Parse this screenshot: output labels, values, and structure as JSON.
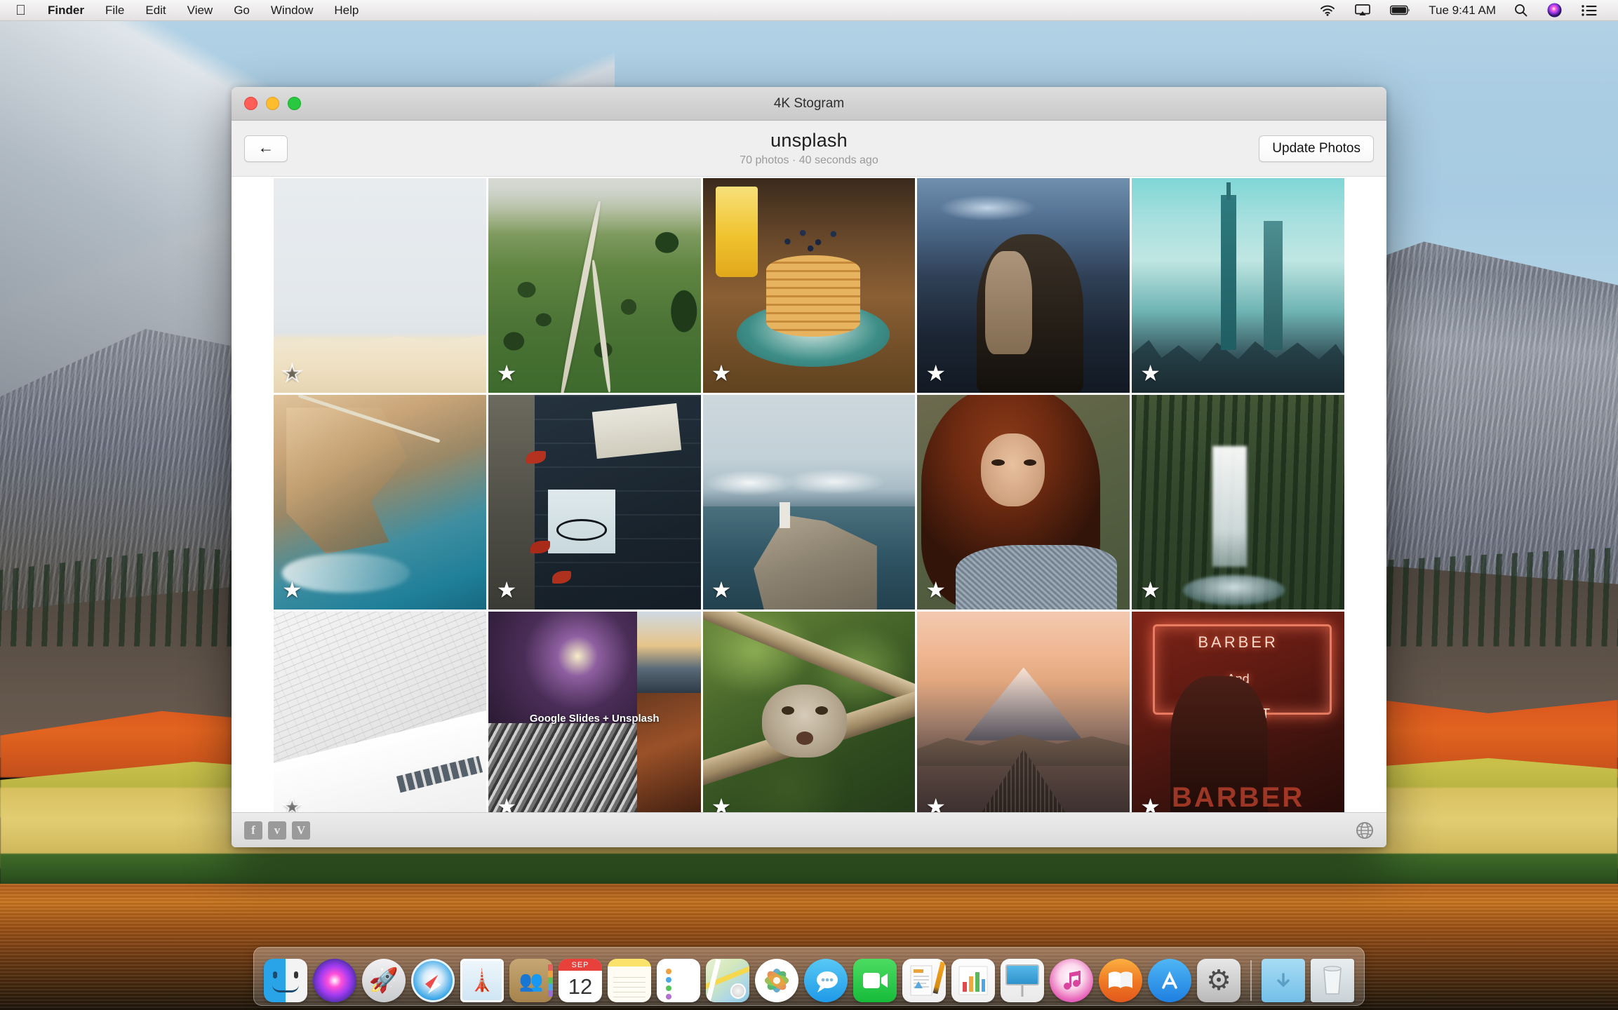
{
  "menubar": {
    "apple_icon": "apple-logo",
    "items": [
      "Finder",
      "File",
      "Edit",
      "View",
      "Go",
      "Window",
      "Help"
    ],
    "status_icons": [
      "wifi-icon",
      "airplay-icon",
      "battery-icon"
    ],
    "clock": "Tue 9:41 AM",
    "right_icons": [
      "search-icon",
      "siri-icon",
      "notification-center-icon"
    ]
  },
  "window": {
    "title": "4K Stogram",
    "traffic_lights": [
      "close-button",
      "minimize-button",
      "zoom-button"
    ],
    "toolbar": {
      "back_label": "←",
      "account_name": "unsplash",
      "subtitle": "70 photos · 40 seconds ago",
      "update_label": "Update Photos"
    },
    "statusbar": {
      "social": [
        {
          "name": "facebook-icon",
          "glyph": "f"
        },
        {
          "name": "twitter-icon",
          "glyph": "ᴠ"
        },
        {
          "name": "vimeo-icon",
          "glyph": "V"
        }
      ],
      "globe_icon": "globe-icon"
    }
  },
  "photos": [
    {
      "id": "photo-1",
      "art": "p-dune",
      "alt": "Sand dune under pale sky",
      "starred": false,
      "caption": ""
    },
    {
      "id": "photo-2",
      "art": "p-hills",
      "alt": "Aerial green hills with winding road",
      "starred": true,
      "caption": ""
    },
    {
      "id": "photo-3",
      "art": "p-pancake",
      "alt": "Blueberry pancake stack with orange juice",
      "starred": true,
      "caption": ""
    },
    {
      "id": "photo-4",
      "art": "p-hood",
      "alt": "Woman in hood looking at phone at dusk",
      "starred": true,
      "caption": ""
    },
    {
      "id": "photo-5",
      "art": "p-city",
      "alt": "Teal city skyline with tall tower",
      "starred": true,
      "caption": ""
    },
    {
      "id": "photo-6",
      "art": "p-coast",
      "alt": "Aerial coastline with turquoise water",
      "starred": true,
      "caption": ""
    },
    {
      "id": "photo-7",
      "art": "p-desk",
      "alt": "Flat lay desk with glasses and envelope",
      "starred": true,
      "caption": ""
    },
    {
      "id": "photo-8",
      "art": "p-light",
      "alt": "Lighthouse on cliff above the sea",
      "starred": true,
      "caption": ""
    },
    {
      "id": "photo-9",
      "art": "p-red",
      "alt": "Portrait of red haired woman",
      "starred": true,
      "caption": ""
    },
    {
      "id": "photo-10",
      "art": "p-fall",
      "alt": "Waterfall in evergreen forest",
      "starred": true,
      "caption": ""
    },
    {
      "id": "photo-11",
      "art": "p-arch",
      "alt": "White curved architectural ceiling",
      "starred": false,
      "caption": ""
    },
    {
      "id": "photo-12",
      "art": "p-collage",
      "alt": "Four photo collage",
      "starred": true,
      "caption": "Google Slides + Unsplash"
    },
    {
      "id": "photo-13",
      "art": "p-monkey",
      "alt": "Monkey resting on a branch",
      "starred": true,
      "caption": ""
    },
    {
      "id": "photo-14",
      "art": "p-volcano",
      "alt": "Volcano crater at sunrise",
      "starred": true,
      "caption": ""
    },
    {
      "id": "photo-15",
      "art": "p-barber",
      "alt": "Neon barber and stylist sign",
      "starred": true,
      "caption": ""
    }
  ],
  "barber_sign": {
    "line1": "BARBER",
    "line2": "And",
    "line3": "STYLIST",
    "line4": "BARBER"
  },
  "calendar_icon": {
    "month": "SEP",
    "day": "12"
  },
  "dock": [
    {
      "name": "finder",
      "label": "Finder",
      "cls": "ic-finder",
      "running": true
    },
    {
      "name": "siri",
      "label": "Siri",
      "cls": "ic-siri",
      "running": false
    },
    {
      "name": "launchpad",
      "label": "Launchpad",
      "cls": "ic-launchpad",
      "running": false
    },
    {
      "name": "safari",
      "label": "Safari",
      "cls": "ic-safari",
      "running": false
    },
    {
      "name": "mail",
      "label": "Mail",
      "cls": "ic-mail",
      "running": false
    },
    {
      "name": "contacts",
      "label": "Contacts",
      "cls": "ic-contacts",
      "running": false
    },
    {
      "name": "calendar",
      "label": "Calendar",
      "cls": "ic-cal",
      "running": false
    },
    {
      "name": "notes",
      "label": "Notes",
      "cls": "ic-notes",
      "running": false
    },
    {
      "name": "reminders",
      "label": "Reminders",
      "cls": "ic-reminders",
      "running": false
    },
    {
      "name": "maps",
      "label": "Maps",
      "cls": "ic-maps",
      "running": false
    },
    {
      "name": "photos",
      "label": "Photos",
      "cls": "ic-photos",
      "running": false
    },
    {
      "name": "messages",
      "label": "Messages",
      "cls": "ic-messages",
      "running": false
    },
    {
      "name": "facetime",
      "label": "FaceTime",
      "cls": "ic-facetime",
      "running": false
    },
    {
      "name": "pages",
      "label": "Pages",
      "cls": "ic-pages",
      "running": false
    },
    {
      "name": "numbers",
      "label": "Numbers",
      "cls": "ic-numbers",
      "running": false
    },
    {
      "name": "keynote",
      "label": "Keynote",
      "cls": "ic-keynote",
      "running": false
    },
    {
      "name": "itunes",
      "label": "iTunes",
      "cls": "ic-itunes",
      "running": false
    },
    {
      "name": "ibooks",
      "label": "iBooks",
      "cls": "ic-ibooks",
      "running": false
    },
    {
      "name": "app-store",
      "label": "App Store",
      "cls": "ic-appstore",
      "running": false
    },
    {
      "name": "system-preferences",
      "label": "System Preferences",
      "cls": "ic-syspref",
      "running": false
    },
    {
      "name": "separator",
      "label": "",
      "cls": "dock-sep",
      "running": false
    },
    {
      "name": "downloads",
      "label": "Downloads",
      "cls": "ic-downloads",
      "running": false
    },
    {
      "name": "trash",
      "label": "Trash",
      "cls": "ic-trash",
      "running": false
    }
  ],
  "colors": {
    "accent": "#2aa4e8",
    "window_chrome": "#d3d3d3",
    "toolbar_bg": "#efefef",
    "star_on": "#ffffff",
    "neon_red": "#ff6a45"
  }
}
